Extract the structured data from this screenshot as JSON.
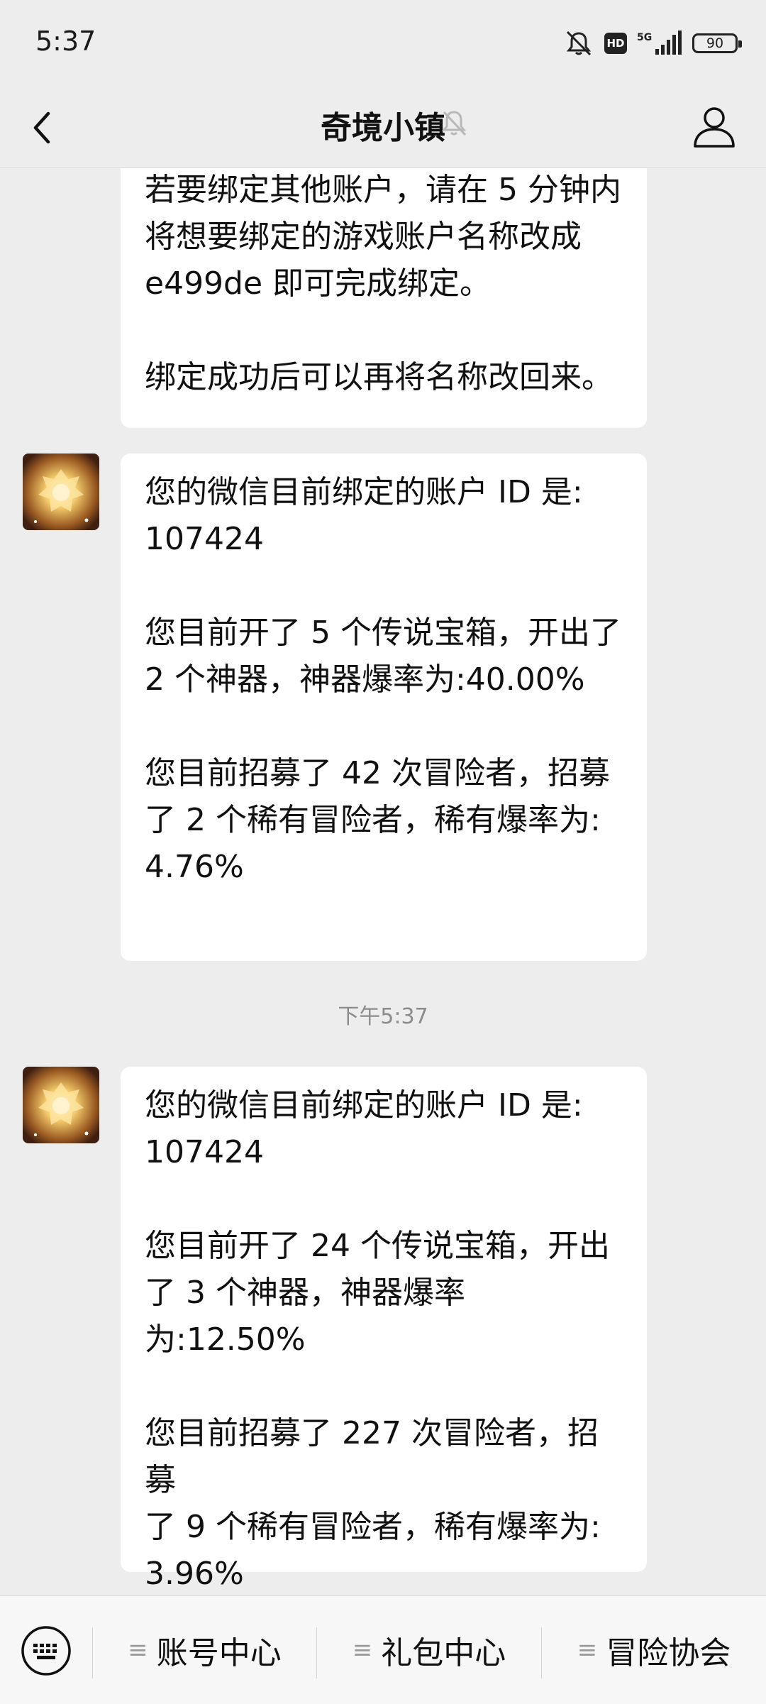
{
  "status_bar": {
    "time": "5:37",
    "signal": "5G",
    "hd": "HD",
    "battery": "90"
  },
  "nav": {
    "title": "奇境小镇",
    "icons": [
      "back-icon",
      "mute-bell-icon",
      "profile-icon"
    ]
  },
  "messages": [
    {
      "sender": "official-account",
      "paragraphs": [
        [
          "若要绑定其他账户，请在 5 分钟内",
          "将想要绑定的游戏账户名称改成",
          "e499de 即可完成绑定。"
        ],
        [
          "绑定成功后可以再将名称改回来。"
        ]
      ]
    },
    {
      "sender": "official-account",
      "paragraphs": [
        [
          "您的微信目前绑定的账户 ID 是:",
          "107424"
        ],
        [
          "您目前开了 5 个传说宝箱，开出了",
          "2 个神器，神器爆率为:40.00%"
        ],
        [
          "您目前招募了 42 次冒险者，招募",
          "了 2 个稀有冒险者，稀有爆率为:",
          "4.76%"
        ]
      ]
    },
    {
      "sender": "official-account",
      "paragraphs": [
        [
          "您的微信目前绑定的账户 ID 是:",
          "107424"
        ],
        [
          "您目前开了 24 个传说宝箱，开出",
          "了 3 个神器，神器爆率为:12.50%"
        ],
        [
          "您目前招募了 227 次冒险者，招募",
          "了 9 个稀有冒险者，稀有爆率为:",
          "3.96%"
        ]
      ]
    }
  ],
  "timestamp": "下午5:37",
  "bottom_menu": {
    "items": [
      "账号中心",
      "礼包中心",
      "冒险协会"
    ],
    "icons": [
      "keyboard-icon",
      "menu-lines-icon"
    ]
  },
  "colors": {
    "background": "#ededed",
    "bubble": "#ffffff",
    "bottom_bar": "#f7f7f7",
    "timestamp": "#8c8c8c"
  }
}
